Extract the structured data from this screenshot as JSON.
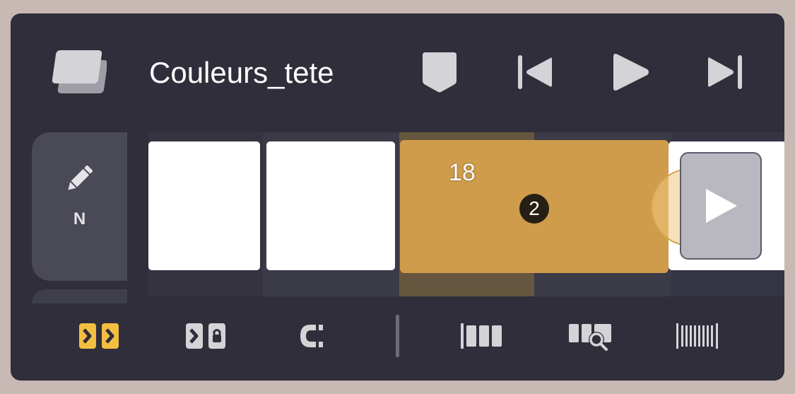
{
  "header": {
    "title": "Couleurs_tete",
    "icons": [
      "layers-icon",
      "keyframe-marker-icon",
      "skip-to-start-icon",
      "play-icon",
      "skip-to-end-icon"
    ]
  },
  "tool_column": {
    "tool_icon": "pencil-icon",
    "mode_label": "N"
  },
  "timeline": {
    "current_frame": "18",
    "selected_exposure": "2",
    "end_icon": "play-icon"
  },
  "toolbar": {
    "icons": [
      "ripple-edit-icon",
      "locked-ripple-icon",
      "magnet-icon",
      "frames-icon",
      "zoom-frames-icon",
      "barcode-compact-icon"
    ],
    "active": "ripple-edit-icon"
  },
  "colors": {
    "panel": "#2f2e3a",
    "accent": "#cf9c4b",
    "active_tool": "#f4be42",
    "icon": "#d4d4d8",
    "outer_bg": "#c8b9b4"
  }
}
